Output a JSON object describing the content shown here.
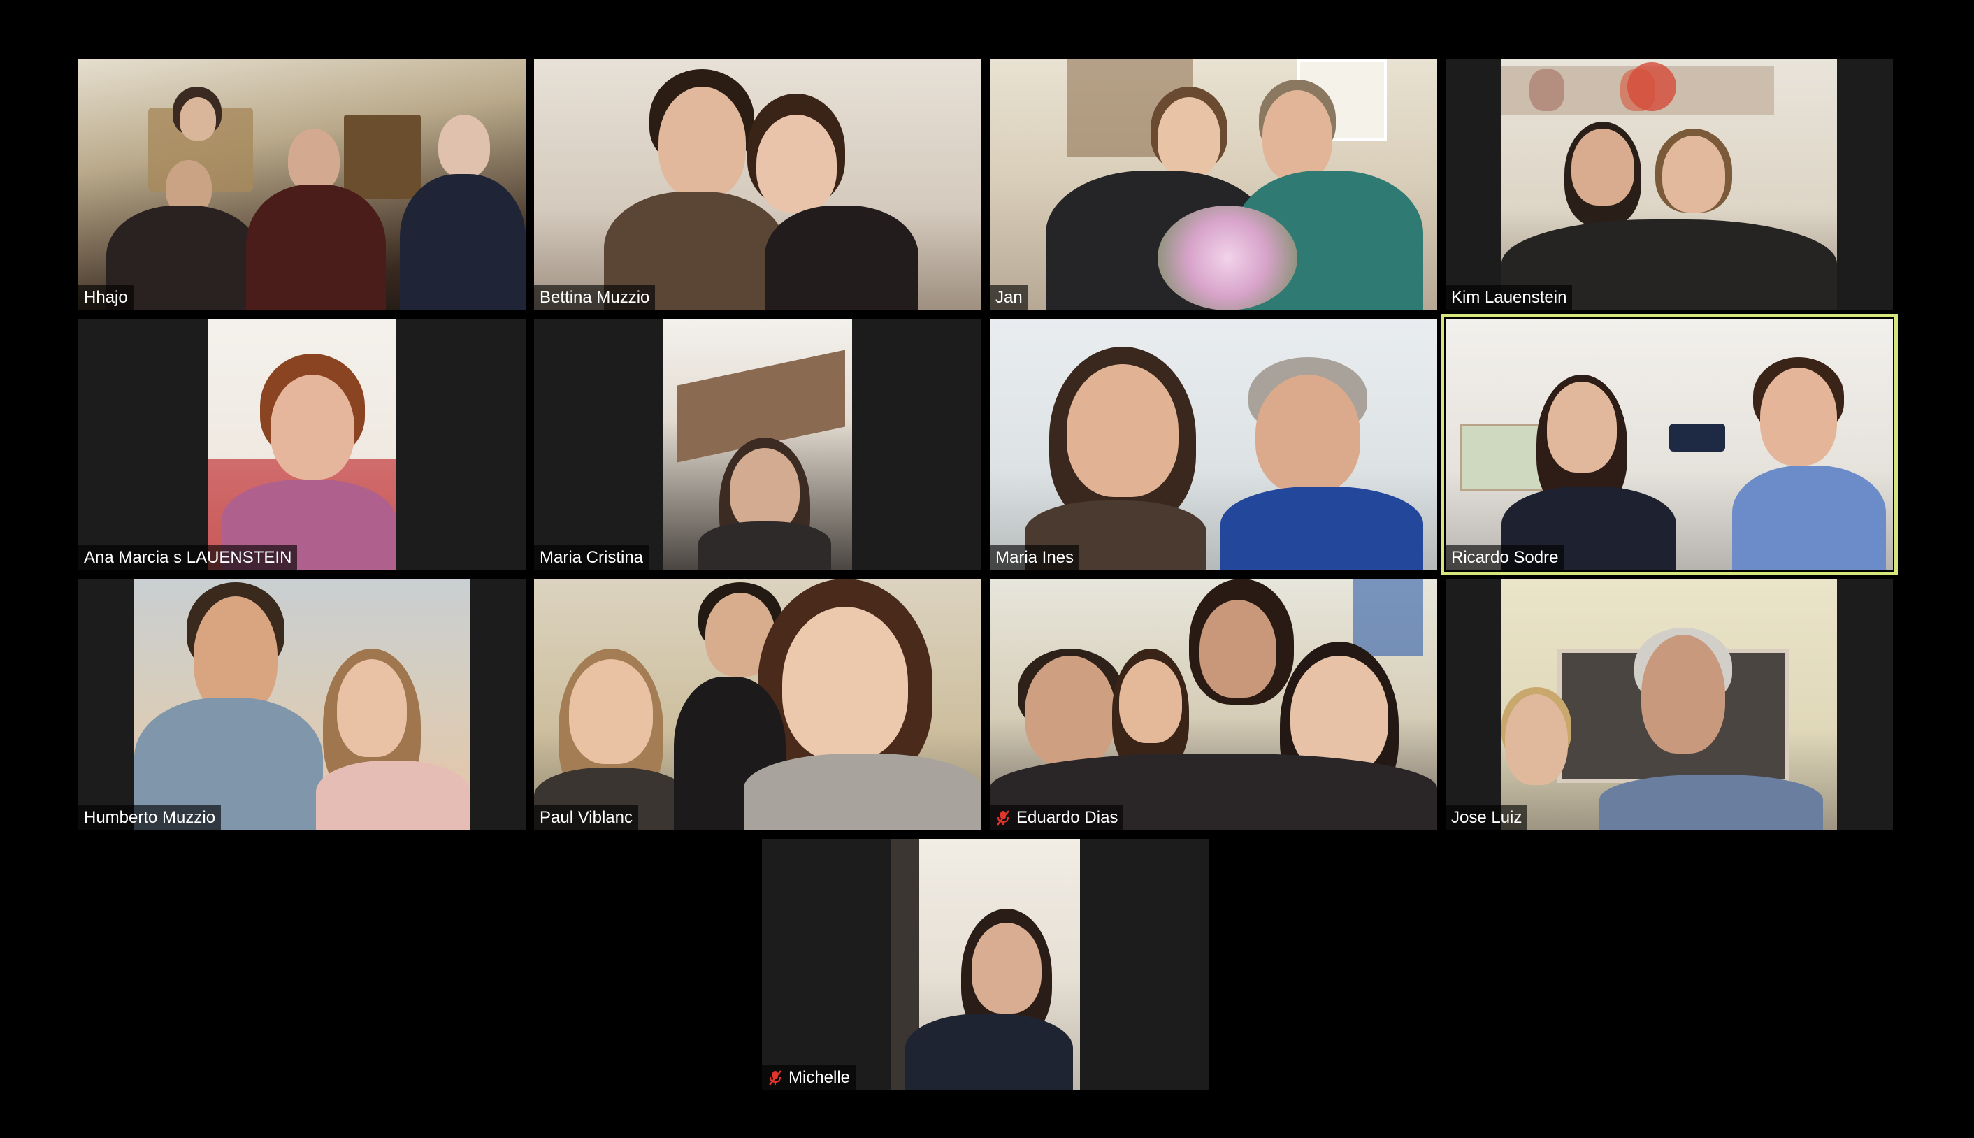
{
  "meeting": {
    "view": "gallery",
    "active_speaker": "Ricardo Sodre",
    "colors": {
      "background": "#000000",
      "tile_background": "#1c1c1c",
      "active_speaker_border": "#d7e67a",
      "muted_icon": "#e0352b",
      "label_text": "#ffffff"
    }
  },
  "participants": [
    {
      "name": "Hhajo",
      "muted": false
    },
    {
      "name": "Bettina Muzzio",
      "muted": false
    },
    {
      "name": "Jan",
      "muted": false
    },
    {
      "name": "Kim Lauenstein",
      "muted": false
    },
    {
      "name": "Ana Marcia s LAUENSTEIN",
      "muted": false
    },
    {
      "name": "Maria Cristina",
      "muted": false
    },
    {
      "name": "Maria Ines",
      "muted": false
    },
    {
      "name": "Ricardo Sodre",
      "muted": false
    },
    {
      "name": "Humberto Muzzio",
      "muted": false
    },
    {
      "name": "Paul Viblanc",
      "muted": false
    },
    {
      "name": "Eduardo Dias",
      "muted": true,
      "icon": "microphone-muted-icon"
    },
    {
      "name": "Jose Luiz",
      "muted": false
    },
    {
      "name": "Michelle",
      "muted": true,
      "icon": "microphone-muted-icon"
    }
  ]
}
